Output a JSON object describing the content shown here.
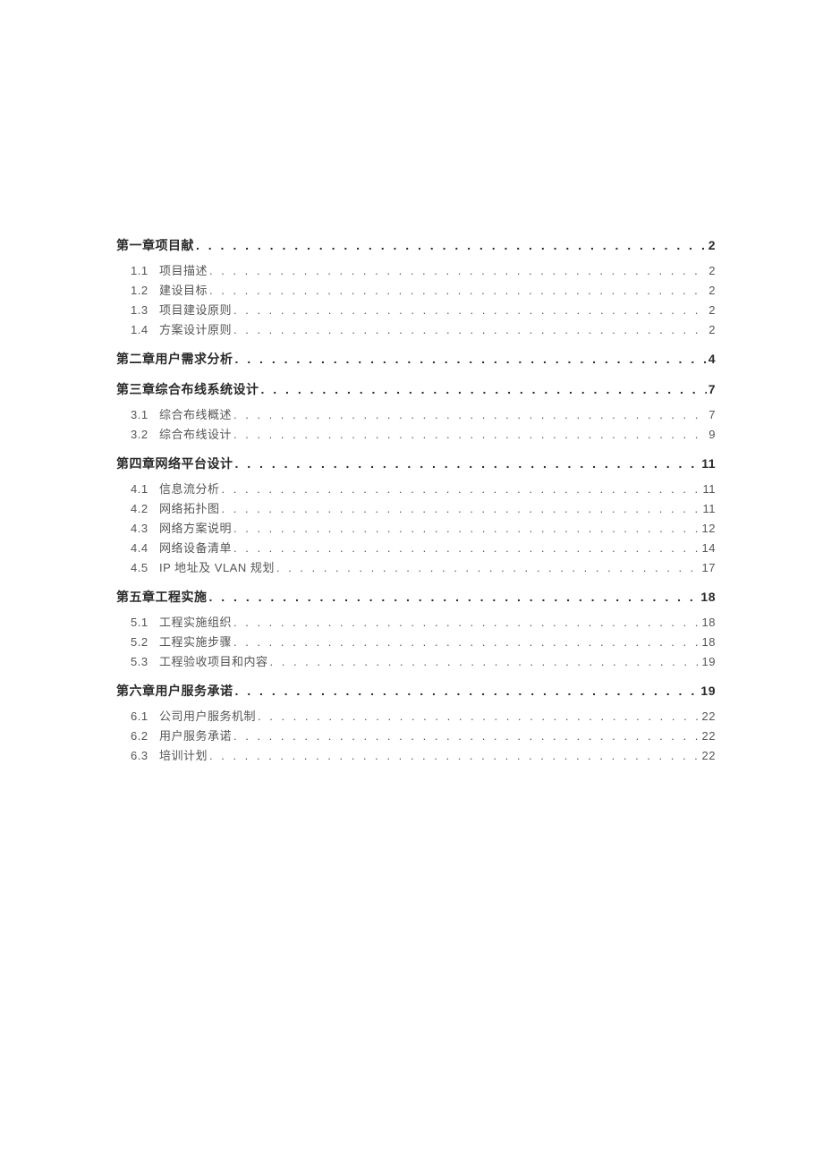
{
  "leader": ". . . . . . . . . . . . . . . . . . . . . . . . . . . . . . . . . . . . . . . . . . . . . . . . . . . . . . . . . . . . . . . . . . . . . . . . . . . . . . . . . . . . . . . . . . . . . . . . . . . . . . . . . . . . . . . . . . . . . . . . . . . . . . . . . . . . . . . . . . . . . . . . . . . . . . . . . . .",
  "toc": [
    {
      "title": "第一章项目献",
      "page": "2",
      "children": [
        {
          "num": "1.1",
          "title": "项目描述",
          "page": "2"
        },
        {
          "num": "1.2",
          "title": "建设目标",
          "page": "2"
        },
        {
          "num": "1.3",
          "title": "项目建设原则",
          "page": "2"
        },
        {
          "num": "1.4",
          "title": "方案设计原则",
          "page": "2"
        }
      ]
    },
    {
      "title": "第二章用户需求分析",
      "page": "4",
      "children": []
    },
    {
      "title": "第三章综合布线系统设计",
      "page": "7",
      "children": [
        {
          "num": "3.1",
          "title": "综合布线概述",
          "page": "7"
        },
        {
          "num": "3.2",
          "title": "综合布线设计",
          "page": "9"
        }
      ]
    },
    {
      "title": "第四章网络平台设计",
      "page": "11",
      "children": [
        {
          "num": "4.1",
          "title": "信息流分析",
          "page": "11"
        },
        {
          "num": "4.2",
          "title": "网络拓扑图",
          "page": "11"
        },
        {
          "num": "4.3",
          "title": "网络方案说明",
          "page": "12"
        },
        {
          "num": "4.4",
          "title": "网络设备清单",
          "page": "14"
        },
        {
          "num": "4.5",
          "title": "IP 地址及 VLAN 规划",
          "page": "17"
        }
      ]
    },
    {
      "title": "第五章工程实施",
      "page": "18",
      "children": [
        {
          "num": "5.1",
          "title": "工程实施组织",
          "page": "18"
        },
        {
          "num": "5.2",
          "title": "工程实施步骤",
          "page": "18"
        },
        {
          "num": "5.3",
          "title": "工程验收项目和内容",
          "page": "19"
        }
      ]
    },
    {
      "title": "第六章用户服务承诺",
      "page": "19",
      "children": [
        {
          "num": "6.1",
          "title": "公司用户服务机制",
          "page": "22"
        },
        {
          "num": "6.2",
          "title": "用户服务承诺",
          "page": "22"
        },
        {
          "num": "6.3",
          "title": "培训计划",
          "page": "22"
        }
      ]
    }
  ]
}
